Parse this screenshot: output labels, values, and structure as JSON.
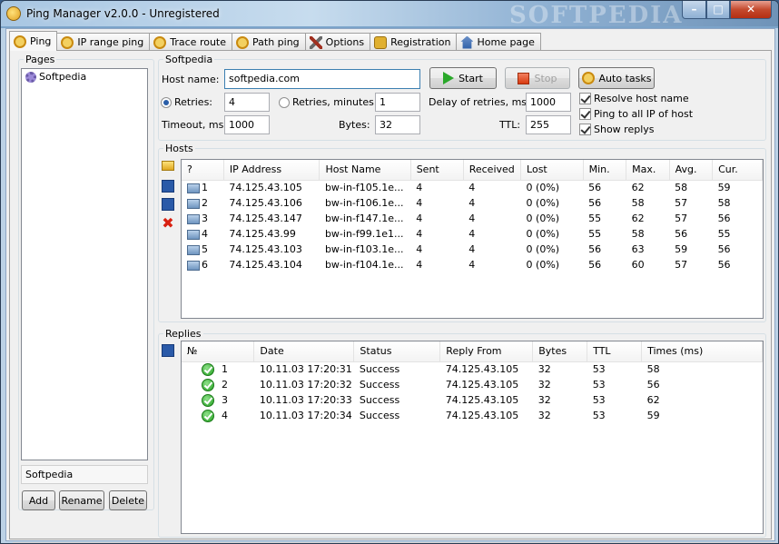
{
  "window": {
    "title": "Ping Manager v2.0.0 - Unregistered",
    "watermark": "SOFTPEDIA"
  },
  "tabs": [
    {
      "label": "Ping",
      "icon": "ping-icon"
    },
    {
      "label": "IP range ping",
      "icon": "ping-icon"
    },
    {
      "label": "Trace route",
      "icon": "ping-icon"
    },
    {
      "label": "Path ping",
      "icon": "ping-icon"
    },
    {
      "label": "Options",
      "icon": "tools-icon"
    },
    {
      "label": "Registration",
      "icon": "lock-icon"
    },
    {
      "label": "Home page",
      "icon": "home-icon"
    }
  ],
  "pages": {
    "title": "Pages",
    "items": [
      "Softpedia"
    ],
    "name_field": "Softpedia",
    "add": "Add",
    "rename": "Rename",
    "delete": "Delete"
  },
  "settings": {
    "group_title": "Softpedia",
    "host_label": "Host name:",
    "host_value": "softpedia.com",
    "start": "Start",
    "stop": "Stop",
    "auto": "Auto tasks",
    "retries_label": "Retries:",
    "retries_value": "4",
    "retries_min_label": "Retries, minutes:",
    "retries_min_value": "1",
    "delay_label": "Delay of retries, ms:",
    "delay_value": "1000",
    "timeout_label": "Timeout, ms:",
    "timeout_value": "1000",
    "bytes_label": "Bytes:",
    "bytes_value": "32",
    "ttl_label": "TTL:",
    "ttl_value": "255",
    "resolve": "Resolve host name",
    "ping_all": "Ping to all IP of host",
    "show_replys": "Show replys"
  },
  "hosts": {
    "title": "Hosts",
    "columns": [
      "?",
      "IP Address",
      "Host Name",
      "Sent",
      "Received",
      "Lost",
      "Min.",
      "Max.",
      "Avg.",
      "Cur."
    ],
    "rows": [
      [
        "1",
        "74.125.43.105",
        "bw-in-f105.1e...",
        "4",
        "4",
        "0 (0%)",
        "56",
        "62",
        "58",
        "59"
      ],
      [
        "2",
        "74.125.43.106",
        "bw-in-f106.1e...",
        "4",
        "4",
        "0 (0%)",
        "56",
        "58",
        "57",
        "58"
      ],
      [
        "3",
        "74.125.43.147",
        "bw-in-f147.1e...",
        "4",
        "4",
        "0 (0%)",
        "55",
        "62",
        "57",
        "56"
      ],
      [
        "4",
        "74.125.43.99",
        "bw-in-f99.1e1...",
        "4",
        "4",
        "0 (0%)",
        "55",
        "58",
        "56",
        "55"
      ],
      [
        "5",
        "74.125.43.103",
        "bw-in-f103.1e...",
        "4",
        "4",
        "0 (0%)",
        "56",
        "63",
        "59",
        "56"
      ],
      [
        "6",
        "74.125.43.104",
        "bw-in-f104.1e...",
        "4",
        "4",
        "0 (0%)",
        "56",
        "60",
        "57",
        "56"
      ]
    ]
  },
  "replies": {
    "title": "Replies",
    "columns": [
      "№",
      "Date",
      "Status",
      "Reply From",
      "Bytes",
      "TTL",
      "Times (ms)"
    ],
    "rows": [
      [
        "1",
        "10.11.03  17:20:31",
        "Success",
        "74.125.43.105",
        "32",
        "53",
        "58"
      ],
      [
        "2",
        "10.11.03  17:20:32",
        "Success",
        "74.125.43.105",
        "32",
        "53",
        "56"
      ],
      [
        "3",
        "10.11.03  17:20:33",
        "Success",
        "74.125.43.105",
        "32",
        "53",
        "62"
      ],
      [
        "4",
        "10.11.03  17:20:34",
        "Success",
        "74.125.43.105",
        "32",
        "53",
        "59"
      ]
    ]
  }
}
